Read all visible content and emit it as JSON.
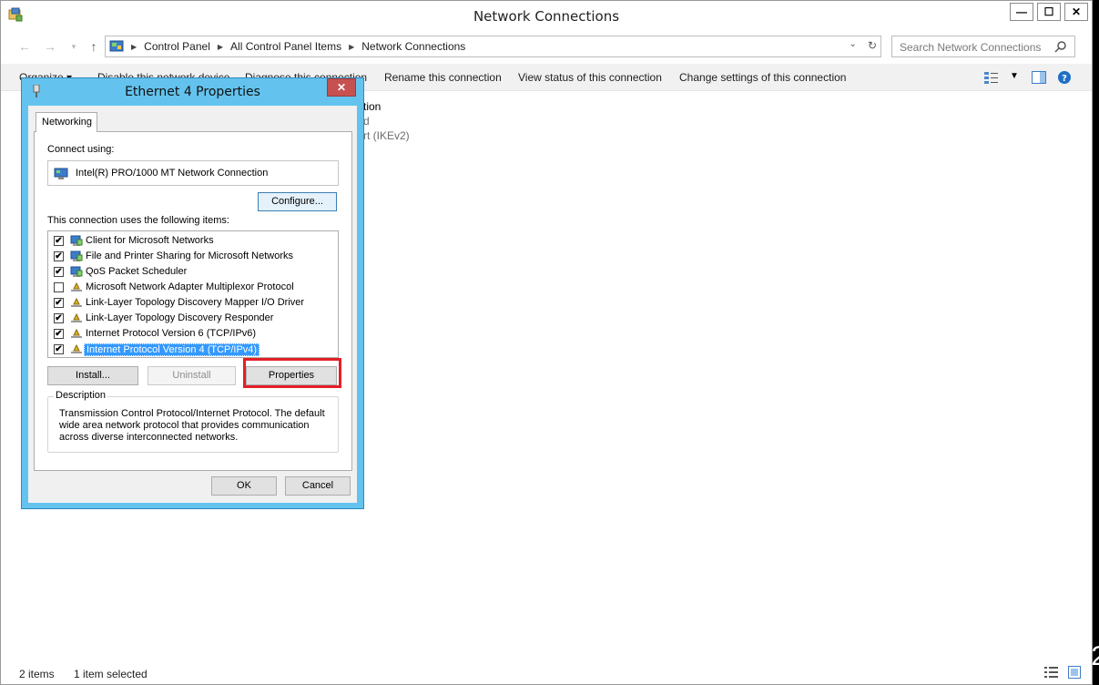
{
  "window": {
    "title": "Network Connections",
    "controls": {
      "minimize": "—",
      "maximize": "☐",
      "close": "✕"
    }
  },
  "nav": {
    "breadcrumbs": [
      "Control Panel",
      "All Control Panel Items",
      "Network Connections"
    ],
    "search_placeholder": "Search Network Connections"
  },
  "commands": {
    "organize": "Organize ▾",
    "disable": "Disable this network device",
    "diagnose": "Diagnose this connection",
    "rename": "Rename this connection",
    "view_status": "View status of this connection",
    "change_settings": "Change settings of this connection"
  },
  "content_fragments": [
    "tion",
    "d",
    "rt (IKEv2)"
  ],
  "status": {
    "count": "2 items",
    "selected": "1 item selected"
  },
  "dialog": {
    "title": "Ethernet 4 Properties",
    "close": "✕",
    "tab": "Networking",
    "connect_using_label": "Connect using:",
    "adapter": "Intel(R) PRO/1000 MT Network Connection",
    "configure_button": "Configure...",
    "items_label": "This connection uses the following items:",
    "items": [
      {
        "label": "Client for Microsoft Networks",
        "checked": true,
        "mark": "✔"
      },
      {
        "label": "File and Printer Sharing for Microsoft Networks",
        "checked": true,
        "mark": "✔"
      },
      {
        "label": "QoS Packet Scheduler",
        "checked": true,
        "mark": "✔"
      },
      {
        "label": "Microsoft Network Adapter Multiplexor Protocol",
        "checked": false,
        "mark": ""
      },
      {
        "label": "Link-Layer Topology Discovery Mapper I/O Driver",
        "checked": true,
        "mark": "✔"
      },
      {
        "label": "Link-Layer Topology Discovery Responder",
        "checked": true,
        "mark": "✔"
      },
      {
        "label": "Internet Protocol Version 6 (TCP/IPv6)",
        "checked": true,
        "mark": "✔"
      },
      {
        "label": "Internet Protocol Version 4 (TCP/IPv4)",
        "checked": true,
        "mark": "✔",
        "selected": true
      }
    ],
    "install_button": "Install...",
    "uninstall_button": "Uninstall",
    "properties_button": "Properties",
    "description_legend": "Description",
    "description": "Transmission Control Protocol/Internet Protocol. The default wide area network protocol that provides communication across diverse interconnected networks.",
    "ok_button": "OK",
    "cancel_button": "Cancel"
  },
  "colors": {
    "dialog_frame": "#63c3ee",
    "close_button": "#c75050",
    "selection": "#3399ff",
    "highlight": "#e41f26"
  }
}
